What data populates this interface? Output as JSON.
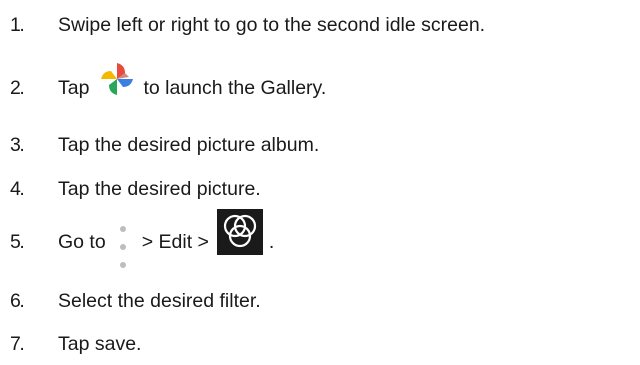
{
  "steps": [
    {
      "number": "1.",
      "text": "Swipe left or right to go to the second idle screen."
    },
    {
      "number": "2.",
      "before": "Tap",
      "icon": "gallery-pinwheel-icon",
      "after": "to launch the Gallery."
    },
    {
      "number": "3.",
      "text": "Tap the desired picture album."
    },
    {
      "number": "4.",
      "text": "Tap the desired picture."
    },
    {
      "number": "5.",
      "before": "Go to",
      "icon": "more-options-icon",
      "middle": "> Edit >",
      "icon2": "filter-icon",
      "after": "."
    },
    {
      "number": "6.",
      "text": "Select the desired filter."
    },
    {
      "number": "7.",
      "text": "Tap save."
    }
  ]
}
